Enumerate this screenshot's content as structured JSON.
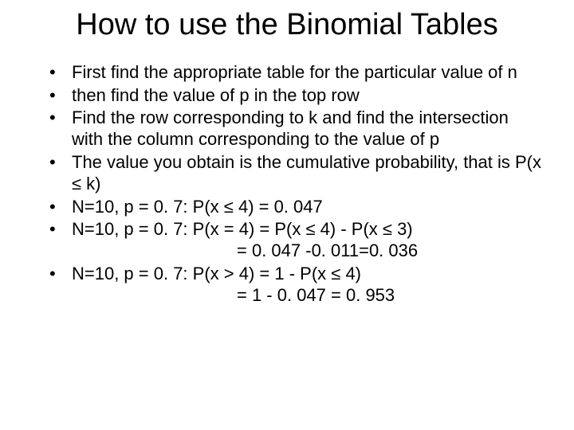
{
  "title": "How to use the Binomial Tables",
  "bullets": [
    "First find the appropriate table for the particular value of n",
    "then find the value of p in the top row",
    "Find the row corresponding to k and find the intersection with the column corresponding to the value of p",
    "The value you obtain is the cumulative probability, that is P(x ≤ k)",
    "N=10, p = 0. 7:  P(x ≤ 4) = 0. 047",
    "N=10, p = 0. 7:  P(x = 4) = P(x ≤ 4) - P(x ≤ 3)",
    "N=10, p = 0. 7:  P(x > 4) = 1 - P(x ≤ 4)"
  ],
  "cont_after_5": "= 0. 047 -0. 011=0. 036",
  "cont_after_6": "= 1 - 0. 047 = 0. 953"
}
